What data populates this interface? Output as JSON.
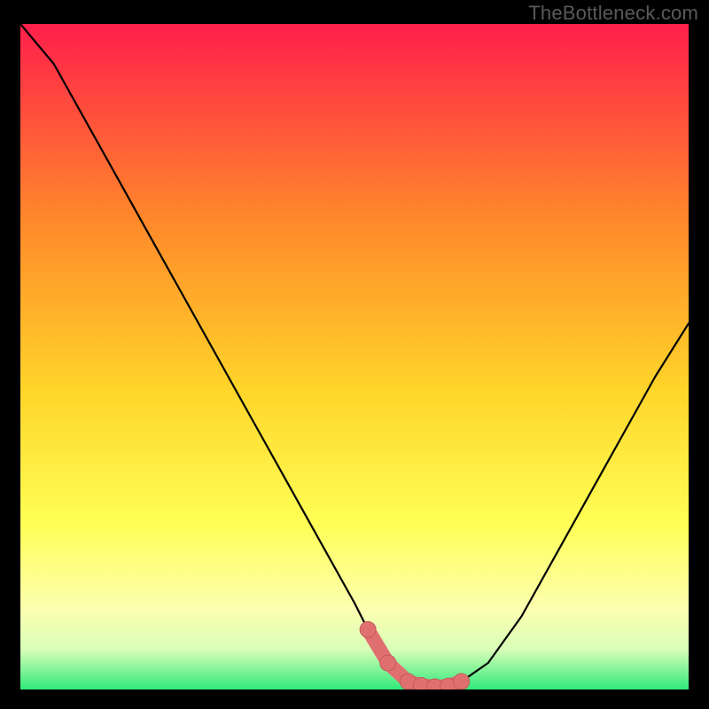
{
  "watermark": "TheBottleneck.com",
  "colors": {
    "bg_black": "#000000",
    "grad_top": "#ff1f4b",
    "grad_mid1": "#ff8a2a",
    "grad_mid2": "#ffd52a",
    "grad_mid3": "#ffff55",
    "grad_mid4": "#fcffb0",
    "grad_bottom": "#2fe97a",
    "curve": "#000000",
    "marker_fill": "#e07070",
    "marker_stroke": "#c45a5a"
  },
  "chart_data": {
    "type": "line",
    "title": "",
    "xlabel": "",
    "ylabel": "",
    "xlim": [
      0,
      100
    ],
    "ylim": [
      0,
      100
    ],
    "series": [
      {
        "name": "bottleneck-curve",
        "x": [
          0,
          5,
          10,
          15,
          20,
          25,
          30,
          35,
          40,
          45,
          50,
          52,
          55,
          58,
          60,
          62,
          64,
          66,
          70,
          75,
          80,
          85,
          90,
          95,
          100
        ],
        "y": [
          100,
          94,
          85,
          76,
          67,
          58,
          49,
          40,
          31,
          22,
          13,
          9,
          4,
          1.2,
          0.6,
          0.4,
          0.5,
          1.2,
          4,
          11,
          20,
          29,
          38,
          47,
          55
        ]
      }
    ],
    "markers": {
      "name": "optimal-range",
      "x": [
        52,
        55,
        58,
        60,
        62,
        64,
        66
      ],
      "y": [
        9,
        4,
        1.2,
        0.6,
        0.4,
        0.5,
        1.2
      ]
    },
    "gradient_bands_pct_from_top": [
      0,
      30,
      55,
      75,
      88,
      94,
      100
    ]
  }
}
